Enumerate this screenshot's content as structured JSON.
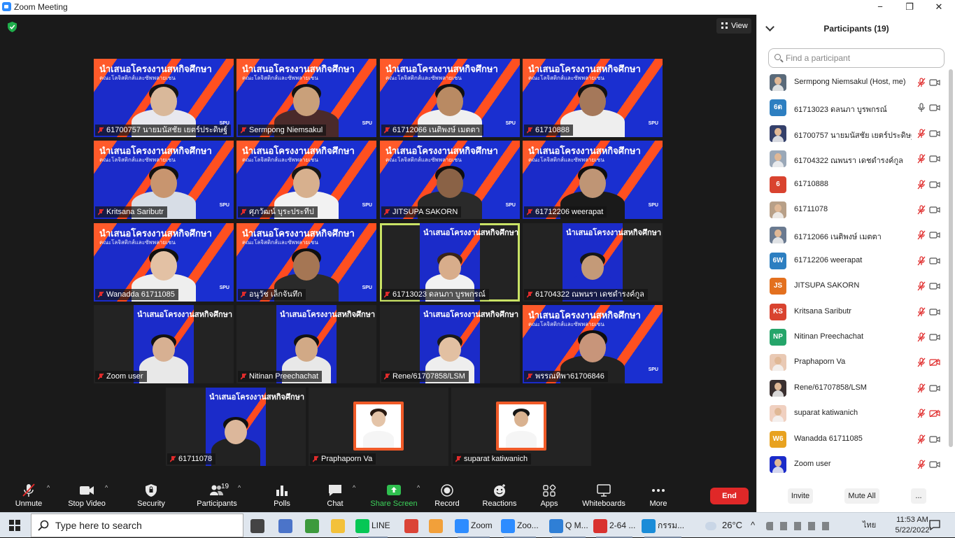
{
  "window": {
    "title": "Zoom Meeting",
    "minimize": "−",
    "maximize": "❐",
    "close": "✕"
  },
  "view_button": {
    "label": "View",
    "icon": "grid-icon"
  },
  "tiles": [
    {
      "name": "61700757 นายมนัสชัย เยตร์ประดิษฐ์",
      "banner": true,
      "skin": "#d9b89a",
      "shirt": "#e8e8ee",
      "hair": "#141414"
    },
    {
      "name": "Sermpong Niemsakul",
      "banner": true,
      "skin": "#c9a07a",
      "shirt": "#4a2a2a",
      "hair": "#111111"
    },
    {
      "name": "61712066 เนติพงษ์ เมตตา",
      "banner": true,
      "skin": "#b98a63",
      "shirt": "#f0f0f0",
      "hair": "#111111"
    },
    {
      "name": "61710888",
      "banner": true,
      "skin": "#a5785a",
      "shirt": "#eeeeee",
      "hair": "#121212"
    },
    {
      "name": "Kritsana Saributr",
      "banner": true,
      "skin": "#c8956f",
      "shirt": "#d7dde6",
      "hair": "#111111"
    },
    {
      "name": "ศุภวัฒน์ บุระประทีป",
      "banner": true,
      "skin": "#d7b08e",
      "shirt": "#f2f2f2",
      "hair": "#161616"
    },
    {
      "name": "JITSUPA SAKORN",
      "banner": true,
      "skin": "#8a6246",
      "shirt": "#2a2a2a",
      "hair": "#0f0f0f"
    },
    {
      "name": "61712206 weerapat",
      "banner": true,
      "skin": "#bf9575",
      "shirt": "#1a1a1a",
      "hair": "#0e0e0e"
    },
    {
      "name": "Wanadda 61711085",
      "banner": true,
      "skin": "#e3c1a4",
      "shirt": "#eeeeee",
      "hair": "#101010"
    },
    {
      "name": "อนุวัช เล็กจันทึก",
      "banner": true,
      "skin": "#a57654",
      "shirt": "#2a2a2a",
      "hair": "#0f0f0f"
    },
    {
      "name": "61713023 ดลนภา บูรพกรณ์",
      "banner": false,
      "mid": true,
      "active": true,
      "skin": "#d8ad8b",
      "shirt": "#f2f2f2",
      "hair": "#3a2418"
    },
    {
      "name": "61704322 ณพนรา เดชดำรงค์กูล",
      "banner": false,
      "mid": true,
      "skin": "#c49a78",
      "shirt": "#1b2bc9",
      "hair": "#161616"
    },
    {
      "name": "Zoom user",
      "banner": false,
      "mid": true,
      "skin": "#d7b092",
      "shirt": "#e8e8e8",
      "hair": "#121212"
    },
    {
      "name": "Nitinan Preechachat",
      "banner": false,
      "mid": true,
      "skin": "#d1a986",
      "shirt": "#e8e8e8",
      "hair": "#121212"
    },
    {
      "name": "Rene/61707858/LSM",
      "banner": false,
      "mid": true,
      "skin": "#e2c0a2",
      "shirt": "#eeeeee",
      "hair": "#1a1a1a"
    },
    {
      "name": "พรรณทิพา61706846",
      "banner": true,
      "skin": "#c8957a",
      "shirt": "#222222",
      "hair": "#0f0f0f"
    },
    {
      "name": "61711078",
      "banner": false,
      "mid": true,
      "skin": "#dcb79b",
      "shirt": "#222222",
      "hair": "#111111"
    },
    {
      "name": "Praphaporn Va",
      "banner": false,
      "thumb": true,
      "skin": "#e4c4a8",
      "shirt": "#f5f5f5",
      "hair": "#2a1a12"
    },
    {
      "name": "suparat katiwanich",
      "banner": false,
      "thumb": true,
      "skin": "#d9b290",
      "shirt": "#f5f5f5",
      "hair": "#151515"
    }
  ],
  "banner_text": {
    "title": "นำเสนอโครงงานสหกิจศึกษา",
    "subtitle": "คณะโลจิสติกส์และซัพพลายเชน",
    "mirrored_title": "นำเสนอโครงงานสหกิจศึกษา",
    "mirrored_subtitle": "คณะโลจิสติกส์และซัพพลายเชน",
    "logo": "SPU"
  },
  "toolbar": [
    {
      "label": "Unmute",
      "icon": "mic-muted-icon",
      "caret": true
    },
    {
      "label": "Stop Video",
      "icon": "video-camera-icon",
      "caret": true
    },
    {
      "label": "Security",
      "icon": "shield-icon",
      "caret": false
    },
    {
      "label": "Participants",
      "icon": "participants-icon",
      "badge": "19",
      "caret": true
    },
    {
      "label": "Polls",
      "icon": "bar-chart-icon",
      "caret": false
    },
    {
      "label": "Chat",
      "icon": "chat-bubble-icon",
      "caret": true
    },
    {
      "label": "Share Screen",
      "icon": "share-screen-icon",
      "caret": true
    },
    {
      "label": "Record",
      "icon": "record-icon",
      "caret": false
    },
    {
      "label": "Reactions",
      "icon": "smiley-icon",
      "caret": false
    },
    {
      "label": "Apps",
      "icon": "apps-icon",
      "caret": false
    },
    {
      "label": "Whiteboards",
      "icon": "whiteboard-icon",
      "caret": false
    },
    {
      "label": "More",
      "icon": "more-dots-icon",
      "caret": false
    }
  ],
  "end_button": "End",
  "panel": {
    "title": "Participants (19)",
    "search_placeholder": "Find a participant",
    "participants": [
      {
        "name": "Sermpong Niemsakul (Host, me)",
        "initials": "",
        "color": "#5a6a7a",
        "photo": true,
        "mic": "muted",
        "video": "on"
      },
      {
        "name": "61713023 ดลนภา บูรพกรณ์",
        "initials": "6ด",
        "color": "#2d7fc1",
        "photo": false,
        "mic": "on",
        "video": "on"
      },
      {
        "name": "61700757 นายมนัสชัย เยตร์ประดิษฐ์",
        "initials": "",
        "color": "#34406a",
        "photo": true,
        "mic": "muted",
        "video": "on"
      },
      {
        "name": "61704322 ณพนรา เดชดำรงค์กูล",
        "initials": "",
        "color": "#9aa8b8",
        "photo": true,
        "mic": "muted",
        "video": "on"
      },
      {
        "name": "61710888",
        "initials": "6",
        "color": "#d9432f",
        "photo": false,
        "mic": "muted",
        "video": "on"
      },
      {
        "name": "61711078",
        "initials": "",
        "color": "#b8a088",
        "photo": true,
        "mic": "muted",
        "video": "on"
      },
      {
        "name": "61712066 เนติพงษ์ เมตตา",
        "initials": "",
        "color": "#6a7a90",
        "photo": true,
        "mic": "muted",
        "video": "on"
      },
      {
        "name": "61712206 weerapat",
        "initials": "6W",
        "color": "#2d7fc1",
        "photo": false,
        "mic": "muted",
        "video": "on"
      },
      {
        "name": "JITSUPA  SAKORN",
        "initials": "JS",
        "color": "#e3701f",
        "photo": false,
        "mic": "muted",
        "video": "on"
      },
      {
        "name": "Kritsana Saributr",
        "initials": "KS",
        "color": "#d9432f",
        "photo": false,
        "mic": "muted",
        "video": "on"
      },
      {
        "name": "Nitinan Preechachat",
        "initials": "NP",
        "color": "#25a56a",
        "photo": false,
        "mic": "muted",
        "video": "on"
      },
      {
        "name": "Praphaporn Va",
        "initials": "",
        "color": "#e9c9b4",
        "photo": true,
        "mic": "muted",
        "video": "off"
      },
      {
        "name": "Rene/61707858/LSM",
        "initials": "",
        "color": "#3a3030",
        "photo": true,
        "mic": "muted",
        "video": "on"
      },
      {
        "name": "suparat katiwanich",
        "initials": "",
        "color": "#f0d0c0",
        "photo": true,
        "mic": "muted",
        "video": "off"
      },
      {
        "name": "Wanadda 61711085",
        "initials": "W6",
        "color": "#e8a21f",
        "photo": false,
        "mic": "muted",
        "video": "on"
      },
      {
        "name": "Zoom user",
        "initials": "",
        "color": "#1b2bc9",
        "photo": true,
        "mic": "muted",
        "video": "on"
      }
    ],
    "footer": {
      "invite": "Invite",
      "mute_all": "Mute All",
      "more": "..."
    }
  },
  "taskbar": {
    "search_placeholder": "Type here to search",
    "apps": [
      {
        "label": "",
        "icon": "task-view-icon",
        "color": "#444444"
      },
      {
        "label": "",
        "icon": "app-icon",
        "color": "#4b74c9"
      },
      {
        "label": "",
        "icon": "spreadsheet-icon",
        "color": "#3c9a3c"
      },
      {
        "label": "",
        "icon": "folder-icon",
        "color": "#f3c13a"
      },
      {
        "label": "LINE",
        "icon": "line-icon",
        "color": "#06c755"
      },
      {
        "label": "",
        "icon": "chrome-icon",
        "color": "#db4437"
      },
      {
        "label": "",
        "icon": "app-icon",
        "color": "#f2a03a"
      },
      {
        "label": "Zoom",
        "icon": "zoom-icon",
        "color": "#2d8cff"
      },
      {
        "label": "Zoo...",
        "icon": "zoom-icon",
        "color": "#2d8cff"
      },
      {
        "label": "Q M...",
        "icon": "ie-icon",
        "color": "#2f7fd6"
      },
      {
        "label": "2-64 ...",
        "icon": "pdf-icon",
        "color": "#d9322f"
      },
      {
        "label": "กรรม...",
        "icon": "edge-icon",
        "color": "#1a8cd8"
      }
    ],
    "weather": "26°C",
    "lang": "ไทย",
    "time": "11:53 AM",
    "date": "5/22/2022"
  }
}
